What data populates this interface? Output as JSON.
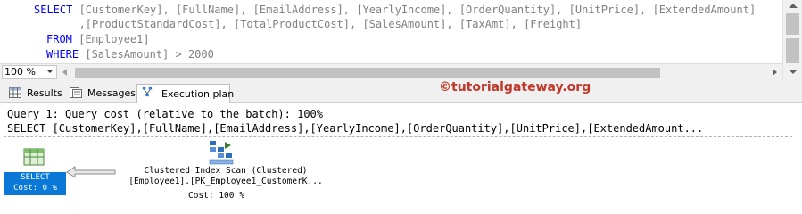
{
  "editor": {
    "line1": {
      "select_kw": "SELECT",
      "rest": " [CustomerKey], [FullName], [EmailAddress], [YearlyIncome], [OrderQuantity], [UnitPrice], [ExtendedAmount]"
    },
    "line2": "       ,[ProductStandardCost], [TotalProductCost], [SalesAmount], [TaxAmt], [Freight]",
    "line3": {
      "from_kw": "FROM",
      "rest": " [Employee1]"
    },
    "line4": {
      "where_kw": "WHERE",
      "rest": " [SalesAmount] > 2000"
    }
  },
  "zoom": {
    "value": "100 %"
  },
  "tabs": [
    {
      "label": "Results",
      "icon": "grid-icon",
      "active": false
    },
    {
      "label": "Messages",
      "icon": "messages-icon",
      "active": false
    },
    {
      "label": "Execution plan",
      "icon": "execution-plan-icon",
      "active": true
    }
  ],
  "watermark": "©tutorialgateway.org",
  "plan": {
    "query_cost_line": "Query 1: Query cost (relative to the batch): 100%",
    "query_text_line": "SELECT [CustomerKey],[FullName],[EmailAddress],[YearlyIncome],[OrderQuantity],[UnitPrice],[ExtendedAmount...",
    "select_node": {
      "label": "SELECT",
      "cost": "Cost: 0 %",
      "icon": "select-icon"
    },
    "scan_node": {
      "title": "Clustered Index Scan (Clustered)",
      "object": "[Employee1].[PK_Employee1_CustomerK...",
      "cost": "Cost: 100 %",
      "icon": "clustered-index-scan-icon"
    }
  },
  "colors": {
    "keyword": "#0000ff",
    "identifier": "#808080",
    "select_node_bg": "#0a78d6",
    "watermark": "#c0392b"
  }
}
